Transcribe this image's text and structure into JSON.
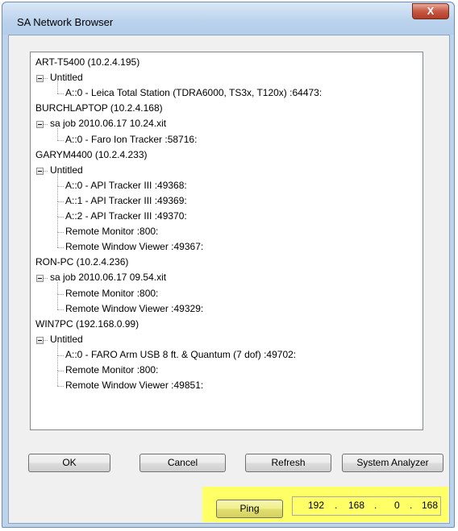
{
  "window": {
    "title": "SA Network Browser",
    "close_label": "X"
  },
  "tree": [
    {
      "level": 0,
      "text": "ART-T5400 (10.2.4.195)"
    },
    {
      "level": 1,
      "text": "Untitled"
    },
    {
      "level": 2,
      "text": "A::0 - Leica Total Station (TDRA6000, TS3x, T120x) :64473:"
    },
    {
      "level": 0,
      "text": "BURCHLAPTOP (10.2.4.168)"
    },
    {
      "level": 1,
      "text": "sa job 2010.06.17 10.24.xit"
    },
    {
      "level": 2,
      "text": "A::0 - Faro Ion Tracker  :58716:"
    },
    {
      "level": 0,
      "text": "GARYM4400 (10.2.4.233)"
    },
    {
      "level": 1,
      "text": "Untitled"
    },
    {
      "level": 2,
      "text": "A::0 - API Tracker III  :49368:"
    },
    {
      "level": 2,
      "text": "A::1 - API Tracker III  :49369:"
    },
    {
      "level": 2,
      "text": "A::2 - API Tracker III  :49370:"
    },
    {
      "level": 2,
      "text": "Remote Monitor  :800:"
    },
    {
      "level": 2,
      "text": "Remote Window Viewer  :49367:"
    },
    {
      "level": 0,
      "text": "RON-PC (10.2.4.236)"
    },
    {
      "level": 1,
      "text": "sa job 2010.06.17 09.54.xit"
    },
    {
      "level": 2,
      "text": "Remote Monitor  :800:"
    },
    {
      "level": 2,
      "text": "Remote Window Viewer  :49329:"
    },
    {
      "level": 0,
      "text": "WIN7PC (192.168.0.99)"
    },
    {
      "level": 1,
      "text": "Untitled"
    },
    {
      "level": 2,
      "text": "A::0 - FARO Arm USB 8 ft. & Quantum (7 dof)  :49702:"
    },
    {
      "level": 2,
      "text": "Remote Monitor  :800:"
    },
    {
      "level": 2,
      "text": "Remote Window Viewer  :49851:"
    }
  ],
  "buttons": {
    "ok": "OK",
    "cancel": "Cancel",
    "refresh": "Refresh",
    "system_analyzer": "System Analyzer",
    "ping": "Ping"
  },
  "ip": {
    "octet1": "192",
    "octet2": "168",
    "octet3": "0",
    "octet4": "168",
    "separator": "."
  },
  "colors": {
    "highlight": "#ffff66",
    "title_bar": "#bad2ec",
    "close_button": "#c75945"
  }
}
